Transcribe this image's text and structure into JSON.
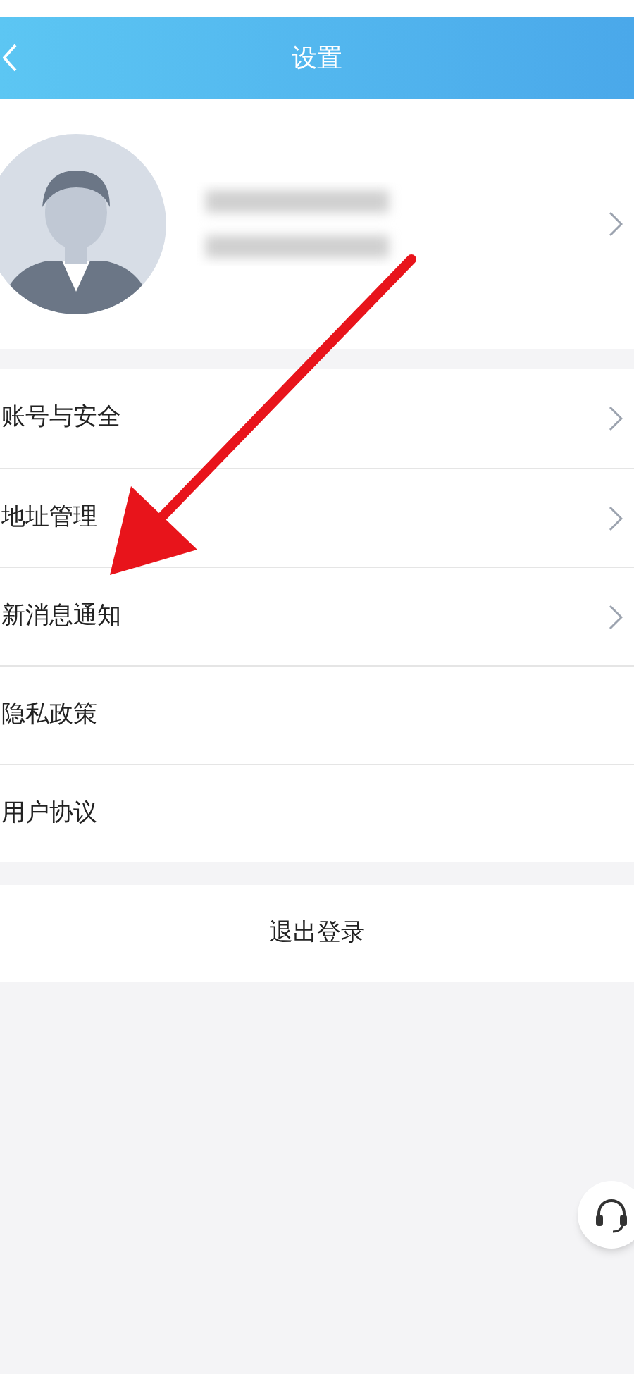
{
  "header": {
    "title": "设置"
  },
  "menu_items": [
    {
      "label": "账号与安全",
      "chevron": true
    },
    {
      "label": "地址管理",
      "chevron": true
    },
    {
      "label": "新消息通知",
      "chevron": true
    },
    {
      "label": "隐私政策",
      "chevron": false
    },
    {
      "label": "用户协议",
      "chevron": false
    }
  ],
  "logout_button": {
    "label": "退出登录"
  }
}
